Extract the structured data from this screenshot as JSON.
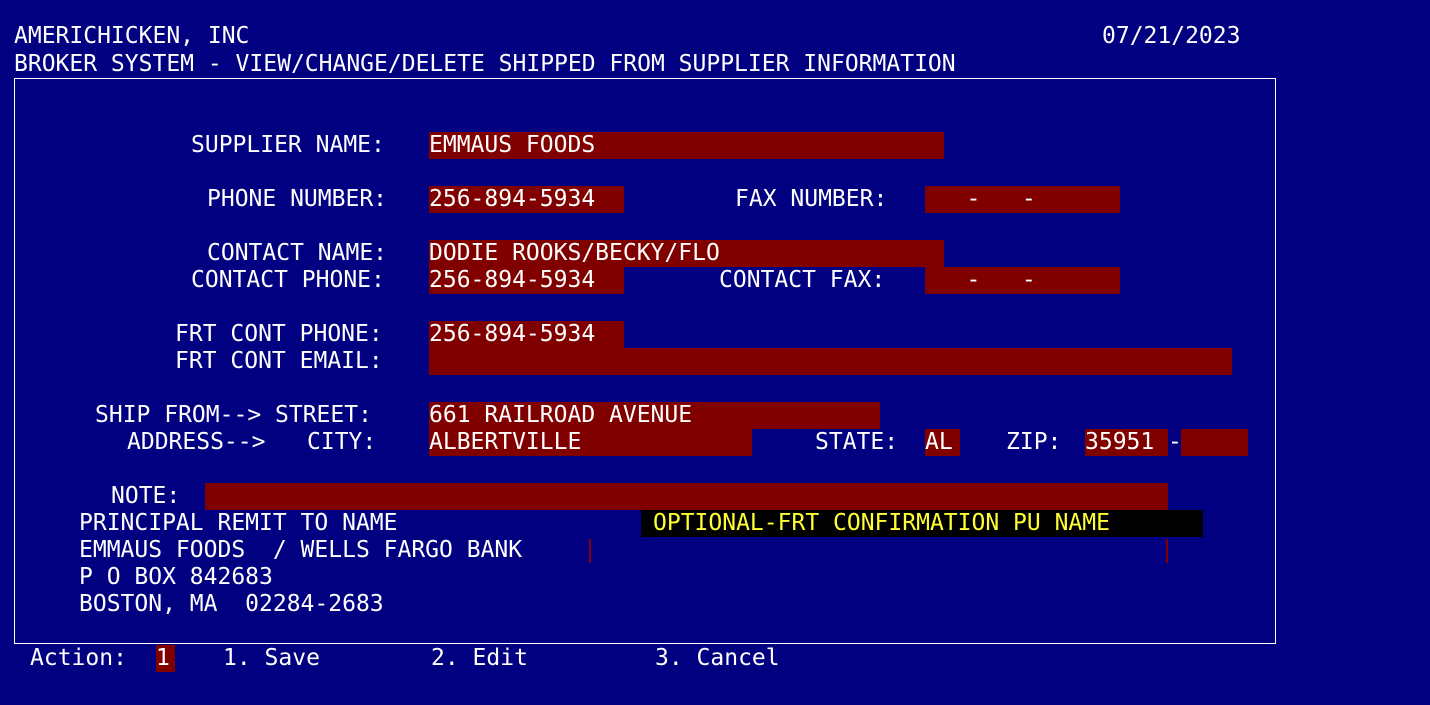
{
  "header": {
    "company": "AMERICHICKEN, INC",
    "date": "07/21/2023",
    "title": "BROKER SYSTEM - VIEW/CHANGE/DELETE SHIPPED FROM SUPPLIER INFORMATION"
  },
  "form": {
    "supplier_name_label": "SUPPLIER NAME:",
    "supplier_name": "EMMAUS FOODS",
    "phone_number_label": "PHONE NUMBER:",
    "phone_number": "256-894-5934",
    "fax_number_label": "FAX NUMBER:",
    "fax_number": "   -   -",
    "contact_name_label": "CONTACT NAME:",
    "contact_name": "DODIE ROOKS/BECKY/FLO",
    "contact_phone_label": "CONTACT PHONE:",
    "contact_phone": "256-894-5934",
    "contact_fax_label": "CONTACT FAX:",
    "contact_fax": "   -   -",
    "frt_cont_phone_label": "FRT CONT PHONE:",
    "frt_cont_phone": "256-894-5934",
    "frt_cont_email_label": "FRT CONT EMAIL:",
    "frt_cont_email": "",
    "ship_from_label": "SHIP FROM--> STREET:",
    "street": "661 RAILROAD AVENUE",
    "address_label": "ADDRESS-->   CITY:",
    "city": "ALBERTVILLE",
    "state_label": "STATE:",
    "state": "AL",
    "zip_label": "ZIP:",
    "zip": "35951",
    "zip_dash": "-",
    "zip_ext": "",
    "note_label": "NOTE:",
    "note": ""
  },
  "remit": {
    "heading": "PRINCIPAL REMIT TO NAME",
    "line1": "EMMAUS FOODS  / WELLS FARGO BANK",
    "line2": "P O BOX 842683",
    "line3": "BOSTON, MA  02284-2683"
  },
  "optional_frt": {
    "label": "OPTIONAL-FRT CONFIRMATION PU NAME"
  },
  "action": {
    "label": "Action:",
    "value": "1",
    "option1": "1. Save",
    "option2": "2. Edit",
    "option3": "3. Cancel"
  },
  "colors": {
    "background": "#000080",
    "field": "#800000",
    "text": "#ffffff",
    "highlight_text": "#ffff33",
    "highlight_bg": "#000000"
  }
}
